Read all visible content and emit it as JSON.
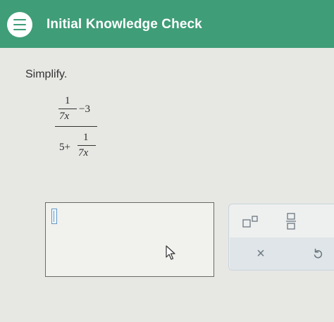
{
  "header": {
    "title": "Initial Knowledge Check",
    "menu_icon": "hamburger-menu-icon"
  },
  "question": {
    "instruction": "Simplify.",
    "expression": {
      "num_fraction_numerator": "1",
      "num_fraction_denominator": "7x",
      "num_minus": "−3",
      "den_prefix": "5+",
      "den_fraction_numerator": "1",
      "den_fraction_denominator": "7x"
    }
  },
  "answer": {
    "value": ""
  },
  "keypad": {
    "exponent_icon": "exponent-icon",
    "fraction_icon": "fraction-icon",
    "clear_label": "×",
    "undo_icon": "undo-icon"
  },
  "colors": {
    "header_green": "#3f9d78",
    "background": "#e7e7e4",
    "caret_blue": "#5f97c6"
  }
}
